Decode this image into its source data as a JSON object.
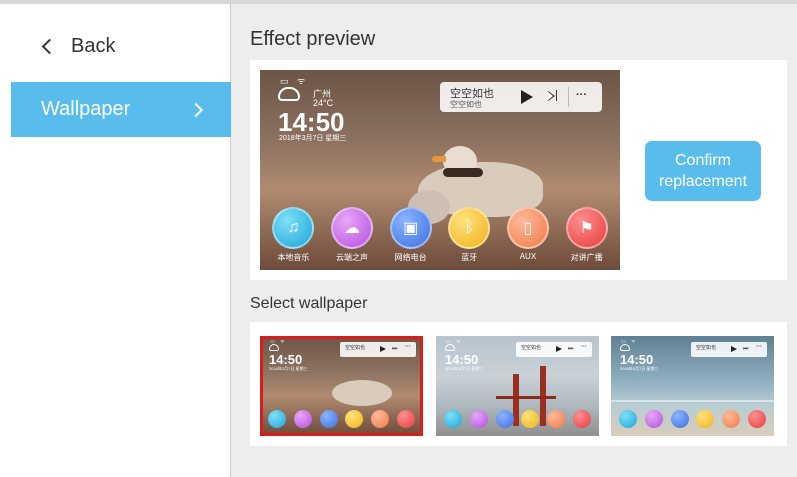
{
  "nav": {
    "back_label": "Back",
    "wallpaper_label": "Wallpaper"
  },
  "main": {
    "effect_preview_title": "Effect preview",
    "select_wallpaper_title": "Select wallpaper",
    "confirm_label": "Confirm replacement"
  },
  "preview": {
    "status_icons": "▭ ᯤ",
    "city": "广州",
    "temperature": "24°C",
    "time": "14:50",
    "date": "2018年3月7日  星期三",
    "music_title": "空空如也",
    "music_artist": "空空如也",
    "more": "···",
    "apps": [
      {
        "label": "本地音乐",
        "icon": "♫"
      },
      {
        "label": "云端之声",
        "icon": "☁"
      },
      {
        "label": "网络电台",
        "icon": "▣"
      },
      {
        "label": "蓝牙",
        "icon": "ᛒ"
      },
      {
        "label": "AUX",
        "icon": "▯"
      },
      {
        "label": "对讲广播",
        "icon": "⚑"
      }
    ]
  },
  "thumbnails": [
    {
      "theme": "bird",
      "time": "14:50",
      "selected": true
    },
    {
      "theme": "bridge",
      "time": "14:50",
      "selected": false
    },
    {
      "theme": "sea",
      "time": "14:50",
      "selected": false
    }
  ],
  "colors": {
    "accent": "#58bdec",
    "selected_outline": "#d81d1d",
    "page_bg": "#ededed"
  }
}
